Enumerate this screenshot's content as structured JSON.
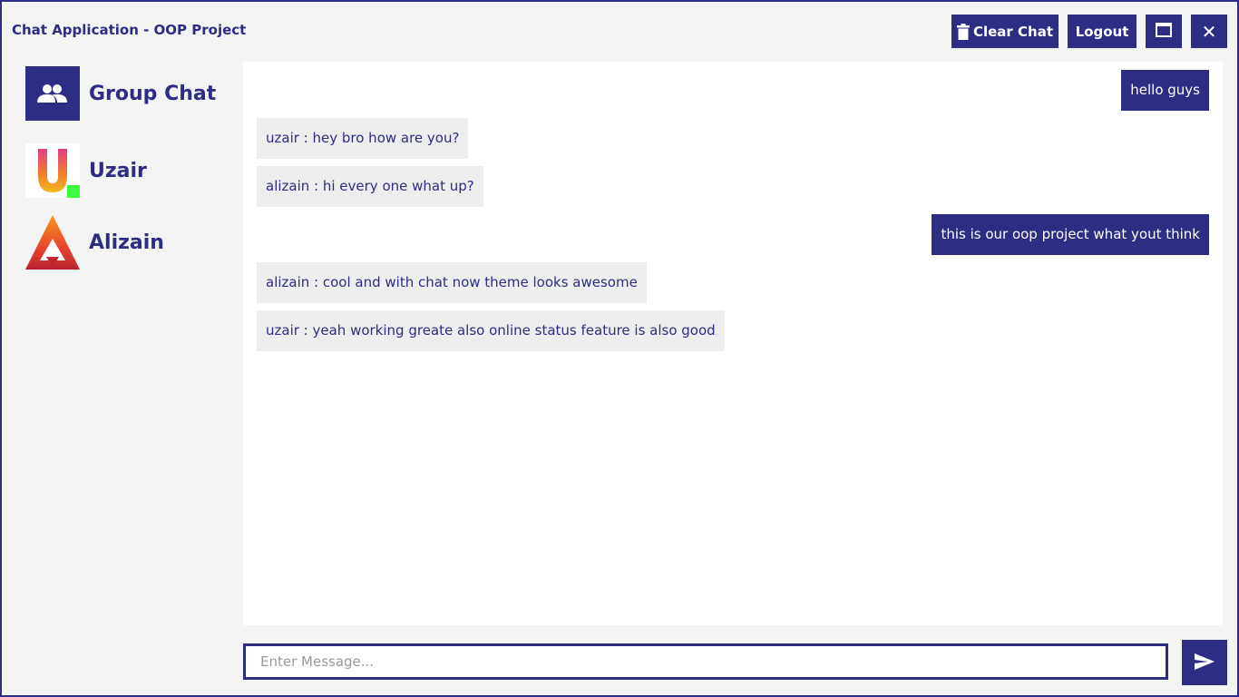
{
  "window": {
    "title": "Chat Application - OOP Project"
  },
  "toolbar": {
    "clear_label": "Clear Chat",
    "logout_label": "Logout",
    "maximize_icon": "maximize-icon",
    "close_icon": "close-icon",
    "close_glyph": "✕"
  },
  "sidebar": {
    "items": [
      {
        "label": "Group Chat",
        "icon": "group-icon"
      },
      {
        "label": "Uzair",
        "icon": "uzair-avatar",
        "status": "online"
      },
      {
        "label": "Alizain",
        "icon": "alizain-avatar"
      }
    ]
  },
  "chat": {
    "messages": [
      {
        "text": "hello guys",
        "mine": true
      },
      {
        "text": "uzair : hey bro how are you?",
        "mine": false
      },
      {
        "text": "alizain : hi every one what up?",
        "mine": false
      },
      {
        "text": "this is our oop project what yout think",
        "mine": true
      },
      {
        "text": "alizain : cool and with chat now theme looks awesome",
        "mine": false
      },
      {
        "text": "uzair : yeah working greate also online status feature is also good",
        "mine": false
      }
    ]
  },
  "composer": {
    "placeholder": "Enter Message...",
    "value": "",
    "send_icon": "send-icon"
  },
  "colors": {
    "accent": "#2d2d84",
    "panel_bg": "#f4f4f4",
    "chat_bg": "#ffffff",
    "other_bubble": "#eeeeee",
    "online": "#3cff3c"
  }
}
